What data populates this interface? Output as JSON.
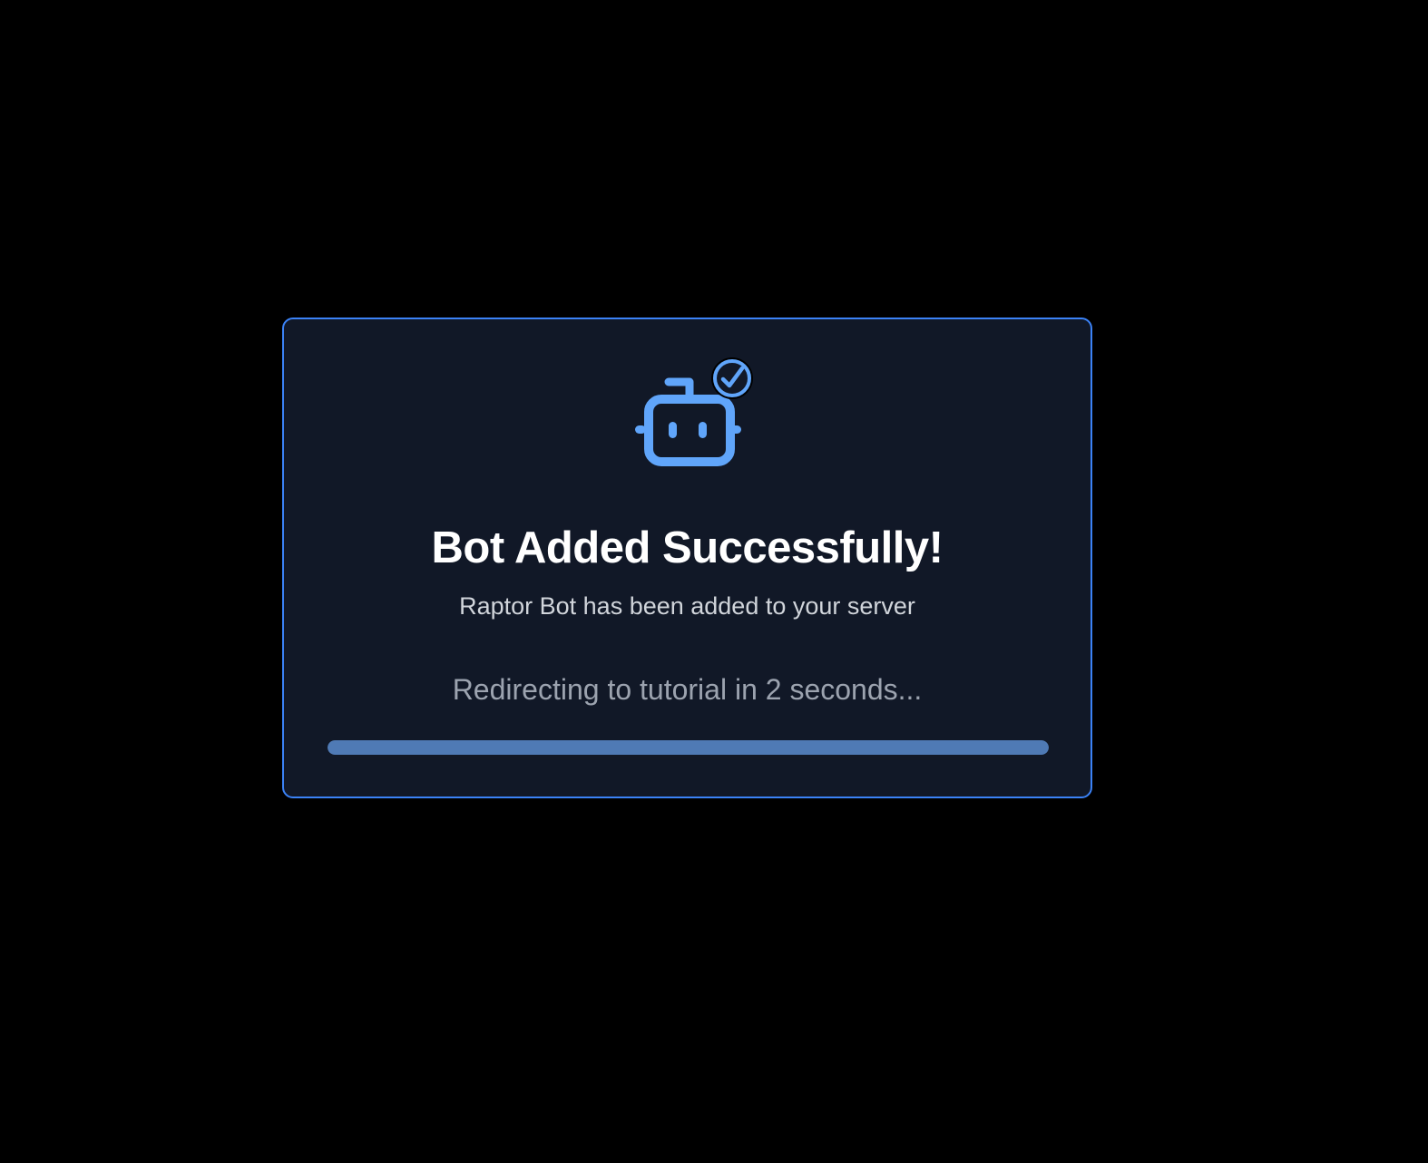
{
  "dialog": {
    "title": "Bot Added Successfully!",
    "subtitle": "Raptor Bot has been added to your server",
    "redirect_message": "Redirecting to tutorial in 2 seconds...",
    "icon": "robot-icon",
    "badge_icon": "check-circle-icon",
    "progress_percent": 100
  },
  "colors": {
    "background": "#000000",
    "card_background": "#111827",
    "card_border": "#3b82f6",
    "accent": "#60a5fa",
    "progress_fill": "#4f7ab5"
  }
}
